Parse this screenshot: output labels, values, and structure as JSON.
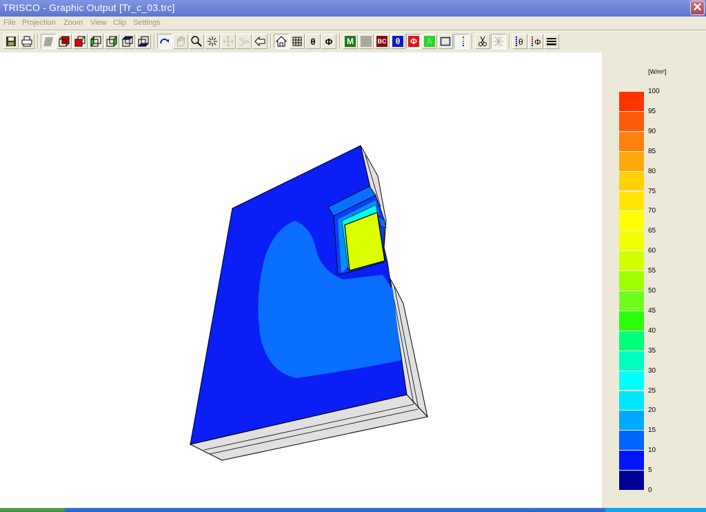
{
  "window": {
    "title": "TRISCO - Graphic Output [Tr_c_03.trc]",
    "close_icon": "close-icon"
  },
  "menu": {
    "items": [
      "File",
      "Projection",
      "Zoom",
      "View",
      "Clip",
      "Settings"
    ]
  },
  "toolbar": {
    "buttons": [
      {
        "icon": "save-icon"
      },
      {
        "icon": "print-icon"
      },
      {
        "icon": "solid-view-icon",
        "pressed": true
      },
      {
        "icon": "cube-red-back-icon"
      },
      {
        "icon": "cube-red-front-icon"
      },
      {
        "icon": "cube-green-left-icon"
      },
      {
        "icon": "cube-green-right-icon"
      },
      {
        "icon": "cube-blue-top-icon"
      },
      {
        "icon": "cube-blue-bottom-icon"
      },
      {
        "icon": "rotate-icon",
        "pressed": true
      },
      {
        "icon": "pan-hand-icon",
        "disabled": true
      },
      {
        "icon": "zoom-magnifier-icon"
      },
      {
        "icon": "zoom-in-center-icon"
      },
      {
        "icon": "move-icon",
        "disabled": true
      },
      {
        "icon": "fly-icon",
        "disabled": true
      },
      {
        "icon": "back-arrow-icon"
      },
      {
        "icon": "home-icon",
        "pressed": true
      },
      {
        "icon": "grid-icon"
      },
      {
        "icon": "theta-icon",
        "label": "θ"
      },
      {
        "icon": "phi-icon",
        "label": "Φ"
      },
      {
        "icon": "material-icon",
        "label": "M"
      },
      {
        "icon": "blank-gray-icon"
      },
      {
        "icon": "boundary-condition-icon",
        "label": "BC"
      },
      {
        "icon": "theta-blue-icon",
        "label": "θ"
      },
      {
        "icon": "phi-red-icon",
        "label": "Φ",
        "pressed": true
      },
      {
        "icon": "area-icon",
        "label": "A"
      },
      {
        "icon": "frame-icon"
      },
      {
        "icon": "color-scale-icon",
        "pressed": true
      },
      {
        "icon": "cut-icon"
      },
      {
        "icon": "cut-disabled-icon",
        "disabled": true,
        "pressed": true
      },
      {
        "icon": "theta-scale-icon",
        "label": "θ"
      },
      {
        "icon": "phi-scale-icon",
        "label": "Φ"
      },
      {
        "icon": "lines-icon"
      }
    ]
  },
  "legend": {
    "unit": "[W/m²]",
    "ticks": [
      "100",
      "95",
      "90",
      "85",
      "80",
      "75",
      "70",
      "65",
      "60",
      "55",
      "50",
      "45",
      "40",
      "35",
      "30",
      "25",
      "20",
      "15",
      "10",
      "5",
      "0"
    ],
    "colors": [
      "#ff3300",
      "#ff5a0a",
      "#ff820f",
      "#ffaa0a",
      "#ffd200",
      "#ffe600",
      "#ffff00",
      "#f0ff00",
      "#d2ff00",
      "#a0ff00",
      "#6eff1e",
      "#2dff0a",
      "#00ff78",
      "#00ffbe",
      "#00ffff",
      "#00e6ff",
      "#00aaff",
      "#0064ff",
      "#0014ff",
      "#000096"
    ]
  },
  "model": {
    "description": "3D heat flux density view of wall with window opening",
    "colors": {
      "wall_face": "#0a1ef5",
      "zone_10_15": "#0a6eff",
      "zone_20_25": "#00b4ff",
      "zone_30": "#00ffee",
      "window_pane": "#dcff00",
      "edge_gray": "#e0e0e0"
    }
  }
}
